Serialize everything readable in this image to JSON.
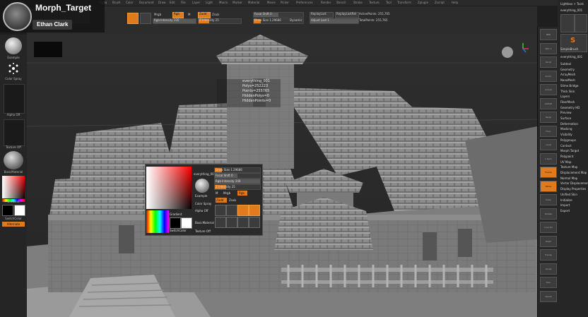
{
  "header": {
    "title": "Morph_Target",
    "author": "Ethan Clark"
  },
  "menu": [
    "Alpha",
    "Brush",
    "Color",
    "Document",
    "Draw",
    "Edit",
    "File",
    "Layer",
    "Light",
    "Macro",
    "Marker",
    "Material",
    "Movie",
    "Picker",
    "Preferences",
    "Render",
    "Stencil",
    "Stroke",
    "Texture",
    "Tool",
    "Transform",
    "Zplugin",
    "Zscript",
    "Help"
  ],
  "toolbar": {
    "mrgb": "Mrgb",
    "rgb": "Rgb",
    "m": "M",
    "zadd": "Zadd",
    "zsub": "Zsub",
    "rgb_intensity": "Rgb Intensity 100",
    "z_intensity": "Z Intensity 25",
    "focal_shift": "Focal Shift 0",
    "draw_size": "Draw Size 1.29686",
    "dynamic": "Dynamic",
    "replay_last": "ReplayLast",
    "replay_last_rel": "ReplayLastRel",
    "adjust_last": "Adjust Last 1",
    "active_points": "ActivePoints: 255,765",
    "total_points": "TotalPoints: 255,765"
  },
  "left_panel": {
    "brush": "Example",
    "stroke": "Color Spray",
    "alpha": "Alpha Off",
    "texture": "Texture Off",
    "material": "BasicMaterial",
    "gradient": "Gradient",
    "switch_color": "SwitchColor",
    "alternate": "Alternate"
  },
  "stats": {
    "name": "everything_001",
    "polys": "Polys=252223",
    "points": "Points=255765",
    "hidden_polys": "HiddenPolys=0",
    "hidden_points": "HiddenPoints=0"
  },
  "popup": {
    "tool_name": "everything_001",
    "draw_size": "Draw Size 1.29686",
    "focal_shift": "Focal Shift 0",
    "rgb_intensity": "Rgb Intensity 100",
    "z_intensity": "Z Intensity 25",
    "brush": "Example",
    "stroke": "Color Spray",
    "alpha": "Alpha Off",
    "texture": "Texture Off",
    "material": "BasicMaterial",
    "m": "M",
    "mrgb": "Mrgb",
    "rgb": "Rgb",
    "zadd": "Zadd",
    "zsub": "Zsub",
    "gradient": "Gradient",
    "switch_color": "SwitchColor"
  },
  "tool_panel": {
    "header": "Lightbox > Tools",
    "current": "everything_001",
    "brush": "SimpleBrush",
    "items": [
      "Subtool",
      "Geometry",
      "ArrayMesh",
      "NanoMesh",
      "Slime Bridge",
      "Thick Skin",
      "Layers",
      "FiberMesh",
      "Geometry HD",
      "Preview",
      "Surface",
      "Deformation",
      "Masking",
      "Visibility",
      "Polygroups",
      "Contact",
      "Morph Target",
      "Polypaint",
      "UV Map",
      "Texture Map",
      "Displacement Map",
      "Normal Map",
      "Vector Displacement Map",
      "Display Properties",
      "Unified Skin",
      "Initialize",
      "Import",
      "Export"
    ]
  },
  "right_dock": [
    "BPR",
    "SPix 3",
    "Scroll",
    "Zoom",
    "Actual",
    "AAHalf",
    "Persp",
    "Floor",
    "Local",
    "L.Sym",
    "Frame",
    "Move",
    "Scale",
    "Rotate",
    "Line Fill",
    "PolyF",
    "Transp",
    "Ghost",
    "Solo",
    "Xpose"
  ],
  "colors": {
    "accent": "#e07a1c",
    "panel": "#262626",
    "viewport": "#2a2a2a"
  }
}
